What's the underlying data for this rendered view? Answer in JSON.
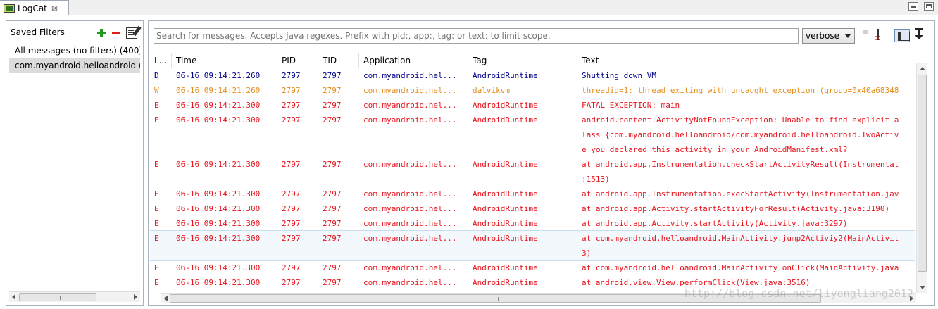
{
  "tab": {
    "title": "LogCat",
    "close": "⊠"
  },
  "filters": {
    "title": "Saved Filters",
    "items": [
      {
        "label": "All messages (no filters) (400)"
      },
      {
        "label": "com.myandroid.helloandroid ("
      }
    ]
  },
  "search": {
    "placeholder": "Search for messages. Accepts Java regexes. Prefix with pid:, app:, tag: or text: to limit scope."
  },
  "level": {
    "value": "verbose"
  },
  "columns": [
    "L...",
    "Time",
    "PID",
    "TID",
    "Application",
    "Tag",
    "Text"
  ],
  "colors": {
    "D": "#00008b",
    "W": "#e38d1e",
    "E": "#e8141d",
    "selection": "#dcdcdc"
  },
  "rows": [
    {
      "level": "D",
      "time": "06-16 09:14:21.260",
      "pid": "2797",
      "tid": "2797",
      "app": "com.myandroid.hel...",
      "tag": "AndroidRuntime",
      "text": [
        "Shutting down VM"
      ]
    },
    {
      "level": "W",
      "time": "06-16 09:14:21.260",
      "pid": "2797",
      "tid": "2797",
      "app": "com.myandroid.hel...",
      "tag": "dalvikvm",
      "text": [
        "threadid=1: thread exiting with uncaught exception (group=0x40a68348"
      ]
    },
    {
      "level": "E",
      "time": "06-16 09:14:21.300",
      "pid": "2797",
      "tid": "2797",
      "app": "com.myandroid.hel...",
      "tag": "AndroidRuntime",
      "text": [
        "FATAL EXCEPTION: main"
      ]
    },
    {
      "level": "E",
      "time": "06-16 09:14:21.300",
      "pid": "2797",
      "tid": "2797",
      "app": "com.myandroid.hel...",
      "tag": "AndroidRuntime",
      "text": [
        "android.content.ActivityNotFoundException: Unable to find explicit a",
        "lass {com.myandroid.helloandroid/com.myandroid.helloandroid.TwoActiv",
        "e you declared this activity in your AndroidManifest.xml?"
      ]
    },
    {
      "level": "E",
      "time": "06-16 09:14:21.300",
      "pid": "2797",
      "tid": "2797",
      "app": "com.myandroid.hel...",
      "tag": "AndroidRuntime",
      "text": [
        "at android.app.Instrumentation.checkStartActivityResult(Instrumentat",
        ":1513)"
      ]
    },
    {
      "level": "E",
      "time": "06-16 09:14:21.300",
      "pid": "2797",
      "tid": "2797",
      "app": "com.myandroid.hel...",
      "tag": "AndroidRuntime",
      "text": [
        "at android.app.Instrumentation.execStartActivity(Instrumentation.jav"
      ]
    },
    {
      "level": "E",
      "time": "06-16 09:14:21.300",
      "pid": "2797",
      "tid": "2797",
      "app": "com.myandroid.hel...",
      "tag": "AndroidRuntime",
      "text": [
        "at android.app.Activity.startActivityForResult(Activity.java:3190)"
      ]
    },
    {
      "level": "E",
      "time": "06-16 09:14:21.300",
      "pid": "2797",
      "tid": "2797",
      "app": "com.myandroid.hel...",
      "tag": "AndroidRuntime",
      "text": [
        "at android.app.Activity.startActivity(Activity.java:3297)"
      ]
    },
    {
      "level": "E",
      "time": "06-16 09:14:21.300",
      "pid": "2797",
      "tid": "2797",
      "app": "com.myandroid.hel...",
      "tag": "AndroidRuntime",
      "text": [
        "at com.myandroid.helloandroid.MainActivity.jump2Activiy2(MainActivit",
        "3)"
      ],
      "highlighted": true
    },
    {
      "level": "E",
      "time": "06-16 09:14:21.300",
      "pid": "2797",
      "tid": "2797",
      "app": "com.myandroid.hel...",
      "tag": "AndroidRuntime",
      "text": [
        "at com.myandroid.helloandroid.MainActivity.onClick(MainActivity.java"
      ]
    },
    {
      "level": "E",
      "time": "06-16 09:14:21.300",
      "pid": "2797",
      "tid": "2797",
      "app": "com.myandroid.hel...",
      "tag": "AndroidRuntime",
      "text": [
        "at android.view.View.performClick(View.java:3516)"
      ]
    }
  ],
  "watermark": "http://blog.csdn.net/liyongliang2012"
}
